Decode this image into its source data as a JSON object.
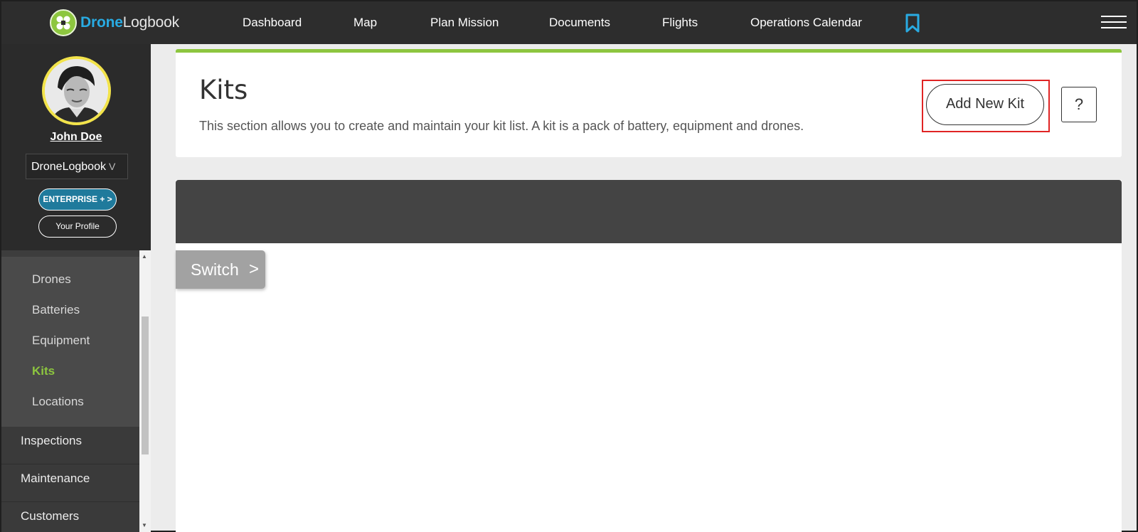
{
  "brand": {
    "part1": "Drone",
    "part2": "Logbook"
  },
  "nav": [
    {
      "label": "Dashboard"
    },
    {
      "label": "Map"
    },
    {
      "label": "Plan Mission"
    },
    {
      "label": "Documents"
    },
    {
      "label": "Flights"
    },
    {
      "label": "Operations Calendar"
    }
  ],
  "icons": {
    "bookmark": "bookmark-icon",
    "menu": "hamburger-menu-icon",
    "help": "help-icon",
    "switch_arrow": "chevron-right-icon",
    "org_dropdown": "chevron-down-icon"
  },
  "user": {
    "name": "John Doe",
    "org": "DroneLogbook",
    "org_chevron": "V"
  },
  "plan_button": "ENTERPRISE + >",
  "profile_button": "Your Profile",
  "sidebar": {
    "submenu": [
      {
        "label": "Drones"
      },
      {
        "label": "Batteries"
      },
      {
        "label": "Equipment"
      },
      {
        "label": "Kits",
        "active": true
      },
      {
        "label": "Locations"
      }
    ],
    "items": [
      {
        "label": "Inspections"
      },
      {
        "label": "Maintenance"
      },
      {
        "label": "Customers"
      }
    ]
  },
  "page": {
    "title": "Kits",
    "description": "This section allows you to create and maintain your kit list. A kit is a pack of battery, equipment and drones.",
    "add_button": "Add New Kit",
    "help_button": "?"
  },
  "switch": {
    "label": "Switch",
    "arrow": ">"
  },
  "colors": {
    "accent_green": "#8dc63f",
    "brand_blue": "#29abe2",
    "enterprise_blue": "#1f7a9c",
    "highlight_red": "#e02424",
    "topbar": "#2d2d2d"
  }
}
